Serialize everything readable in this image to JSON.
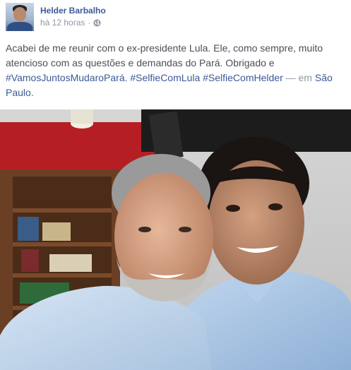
{
  "post": {
    "author": "Helder Barbalho",
    "timestamp": "há 12 horas",
    "separator": "·",
    "privacy_icon": "globe-icon",
    "text": {
      "body": "Acabei de me reunir com o ex-presidente Lula. Ele, como sempre, muito atencioso com as questões e demandas do Pará. Obrigado e",
      "hashtags": [
        "#VamosJuntosMudaroPará.",
        "#SelfieComLula",
        "#SelfieComHelder"
      ],
      "location_prefix": "— em",
      "location": "São Paulo."
    }
  },
  "colors": {
    "link": "#3b5998",
    "meta": "#9197a3",
    "text": "#4b4f56"
  }
}
